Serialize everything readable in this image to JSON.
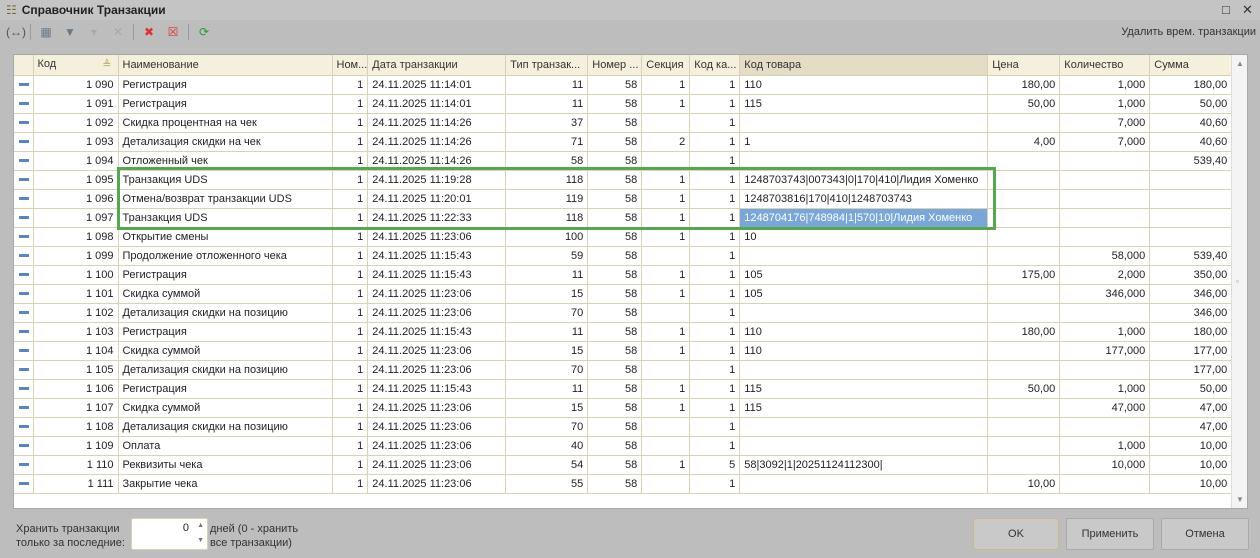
{
  "window": {
    "title": "Справочник Транзакции",
    "icon": "table-icon"
  },
  "toolbar": {
    "right_link": "Удалить врем. транзакции"
  },
  "columns": [
    "Код",
    "Наименование",
    "Ном...",
    "Дата транзакции",
    "Тип транзак...",
    "Номер ...",
    "Секция",
    "Код ка...",
    "Код товара",
    "Цена",
    "Количество",
    "Сумма"
  ],
  "rows": [
    [
      "1 090",
      "Регистрация",
      "1",
      "24.11.2025 11:14:01",
      "11",
      "58",
      "1",
      "1",
      "110",
      "180,00",
      "1,000",
      "180,00"
    ],
    [
      "1 091",
      "Регистрация",
      "1",
      "24.11.2025 11:14:01",
      "11",
      "58",
      "1",
      "1",
      "115",
      "50,00",
      "1,000",
      "50,00"
    ],
    [
      "1 092",
      "Скидка процентная на чек",
      "1",
      "24.11.2025 11:14:26",
      "37",
      "58",
      "",
      "1",
      "",
      "",
      "7,000",
      "40,60"
    ],
    [
      "1 093",
      "Детализация скидки на чек",
      "1",
      "24.11.2025 11:14:26",
      "71",
      "58",
      "2",
      "1",
      "1",
      "4,00",
      "7,000",
      "40,60"
    ],
    [
      "1 094",
      "Отложенный чек",
      "1",
      "24.11.2025 11:14:26",
      "58",
      "58",
      "",
      "1",
      "",
      "",
      "",
      "539,40"
    ],
    [
      "1 095",
      "Транзакция UDS",
      "1",
      "24.11.2025 11:19:28",
      "118",
      "58",
      "1",
      "1",
      "1248703743|007343|0|170|410|Лидия Хоменко",
      "",
      "",
      ""
    ],
    [
      "1 096",
      "Отмена/возврат транзакции UDS",
      "1",
      "24.11.2025 11:20:01",
      "119",
      "58",
      "1",
      "1",
      "1248703816|170|410|1248703743",
      "",
      "",
      ""
    ],
    [
      "1 097",
      "Транзакция UDS",
      "1",
      "24.11.2025 11:22:33",
      "118",
      "58",
      "1",
      "1",
      "1248704176|748984|1|570|10|Лидия Хоменко",
      "",
      "",
      ""
    ],
    [
      "1 098",
      "Открытие смены",
      "1",
      "24.11.2025 11:23:06",
      "100",
      "58",
      "1",
      "1",
      "10",
      "",
      "",
      ""
    ],
    [
      "1 099",
      "Продолжение отложенного чека",
      "1",
      "24.11.2025 11:15:43",
      "59",
      "58",
      "",
      "1",
      "",
      "",
      "58,000",
      "539,40"
    ],
    [
      "1 100",
      "Регистрация",
      "1",
      "24.11.2025 11:15:43",
      "11",
      "58",
      "1",
      "1",
      "105",
      "175,00",
      "2,000",
      "350,00"
    ],
    [
      "1 101",
      "Скидка суммой",
      "1",
      "24.11.2025 11:23:06",
      "15",
      "58",
      "1",
      "1",
      "105",
      "",
      "346,000",
      "346,00"
    ],
    [
      "1 102",
      "Детализация скидки на позицию",
      "1",
      "24.11.2025 11:23:06",
      "70",
      "58",
      "",
      "1",
      "",
      "",
      "",
      "346,00"
    ],
    [
      "1 103",
      "Регистрация",
      "1",
      "24.11.2025 11:15:43",
      "11",
      "58",
      "1",
      "1",
      "110",
      "180,00",
      "1,000",
      "180,00"
    ],
    [
      "1 104",
      "Скидка суммой",
      "1",
      "24.11.2025 11:23:06",
      "15",
      "58",
      "1",
      "1",
      "110",
      "",
      "177,000",
      "177,00"
    ],
    [
      "1 105",
      "Детализация скидки на позицию",
      "1",
      "24.11.2025 11:23:06",
      "70",
      "58",
      "",
      "1",
      "",
      "",
      "",
      "177,00"
    ],
    [
      "1 106",
      "Регистрация",
      "1",
      "24.11.2025 11:15:43",
      "11",
      "58",
      "1",
      "1",
      "115",
      "50,00",
      "1,000",
      "50,00"
    ],
    [
      "1 107",
      "Скидка суммой",
      "1",
      "24.11.2025 11:23:06",
      "15",
      "58",
      "1",
      "1",
      "115",
      "",
      "47,000",
      "47,00"
    ],
    [
      "1 108",
      "Детализация скидки на позицию",
      "1",
      "24.11.2025 11:23:06",
      "70",
      "58",
      "",
      "1",
      "",
      "",
      "",
      "47,00"
    ],
    [
      "1 109",
      "Оплата",
      "1",
      "24.11.2025 11:23:06",
      "40",
      "58",
      "",
      "1",
      "",
      "",
      "1,000",
      "10,00"
    ],
    [
      "1 110",
      "Реквизиты чека",
      "1",
      "24.11.2025 11:23:06",
      "54",
      "58",
      "1",
      "5",
      "58|3092|1|20251124112300|",
      "",
      "10,000",
      "10,00"
    ],
    [
      "1 111",
      "Закрытие чека",
      "1",
      "24.11.2025 11:23:06",
      "55",
      "58",
      "",
      "1",
      "",
      "10,00",
      "",
      "10,00"
    ]
  ],
  "selected_row": "1 097",
  "highlight_color": "#55a84f",
  "footer": {
    "keep_label_1": "Хранить транзакции",
    "keep_label_2": "только за последние:",
    "days_value": "0",
    "days_hint_1": "дней (0 - хранить",
    "days_hint_2": "все транзакции)",
    "ok": "OK",
    "apply": "Применить",
    "cancel": "Отмена"
  }
}
